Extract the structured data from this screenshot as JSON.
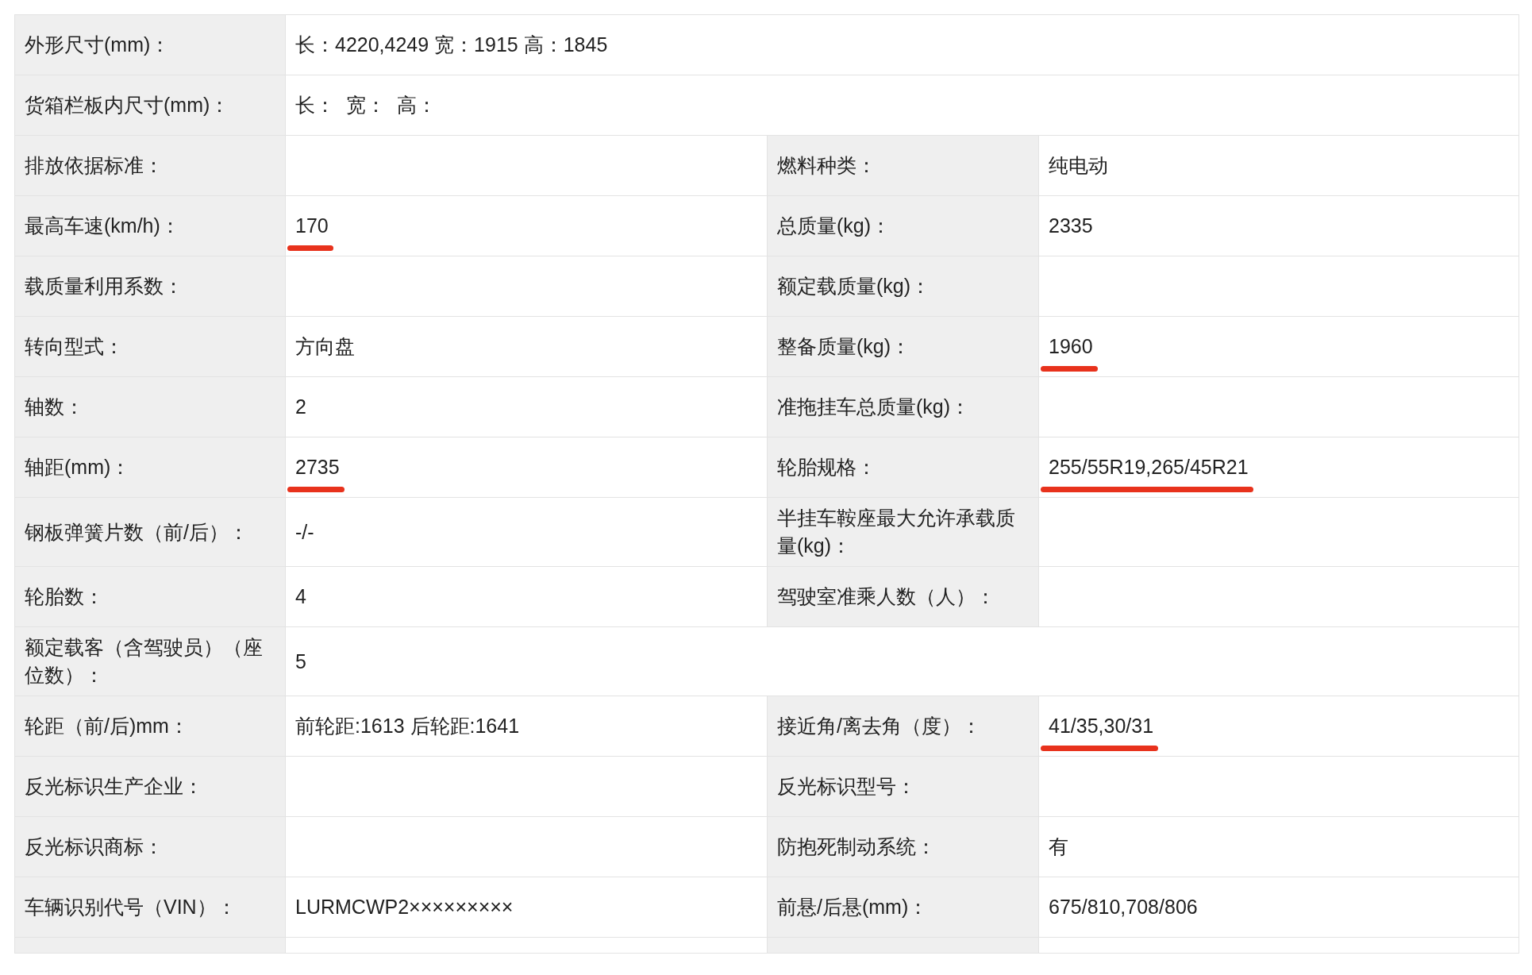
{
  "rows": [
    {
      "kind": "full",
      "label": "外形尺寸(mm)：",
      "value": "长：4220,4249 宽：1915 高：1845"
    },
    {
      "kind": "full",
      "label": "货箱栏板内尺寸(mm)：",
      "value": "长：  宽：  高："
    },
    {
      "kind": "split",
      "cells": [
        {
          "label": "排放依据标准："
        },
        {
          "label": "燃料种类：",
          "value": "纯电动"
        }
      ]
    },
    {
      "kind": "split",
      "cells": [
        {
          "label": "最高车速(km/h)：",
          "value": "170",
          "underlined": true
        },
        {
          "label": "总质量(kg)：",
          "value": "2335"
        }
      ]
    },
    {
      "kind": "split",
      "cells": [
        {
          "label": "载质量利用系数："
        },
        {
          "label": "额定载质量(kg)："
        }
      ]
    },
    {
      "kind": "split",
      "cells": [
        {
          "label": "转向型式：",
          "value": "方向盘"
        },
        {
          "label": "整备质量(kg)：",
          "value": "1960",
          "underlined": true
        }
      ]
    },
    {
      "kind": "split",
      "cells": [
        {
          "label": "轴数：",
          "value": "2"
        },
        {
          "label": "准拖挂车总质量(kg)："
        }
      ]
    },
    {
      "kind": "split",
      "cells": [
        {
          "label": "轴距(mm)：",
          "value": "2735",
          "underlined": true
        },
        {
          "label": "轮胎规格：",
          "value": "255/55R19,265/45R21",
          "underlined": true
        }
      ]
    },
    {
      "kind": "split",
      "cells": [
        {
          "label": "钢板弹簧片数（前/后）：",
          "value": "-/-"
        },
        {
          "label": "半挂车鞍座最大允许承载质量(kg)："
        }
      ]
    },
    {
      "kind": "split",
      "cells": [
        {
          "label": "轮胎数：",
          "value": "4"
        },
        {
          "label": "驾驶室准乘人数（人）："
        }
      ]
    },
    {
      "kind": "full",
      "label": "额定载客（含驾驶员）（座位数）：",
      "value": "5"
    },
    {
      "kind": "split",
      "cells": [
        {
          "label": "轮距（前/后)mm：",
          "value": "前轮距:1613 后轮距:1641"
        },
        {
          "label": "接近角/离去角（度）：",
          "value": "41/35,30/31",
          "underlined": true
        }
      ]
    },
    {
      "kind": "split",
      "cells": [
        {
          "label": "反光标识生产企业："
        },
        {
          "label": "反光标识型号："
        }
      ]
    },
    {
      "kind": "split",
      "cells": [
        {
          "label": "反光标识商标："
        },
        {
          "label": "防抱死制动系统：",
          "value": "有"
        }
      ]
    },
    {
      "kind": "split",
      "cells": [
        {
          "label": "车辆识别代号（VIN）：",
          "value": "LURMCWP2×××××××××"
        },
        {
          "label": "前悬/后悬(mm)：",
          "value": "675/810,708/806"
        }
      ]
    }
  ]
}
